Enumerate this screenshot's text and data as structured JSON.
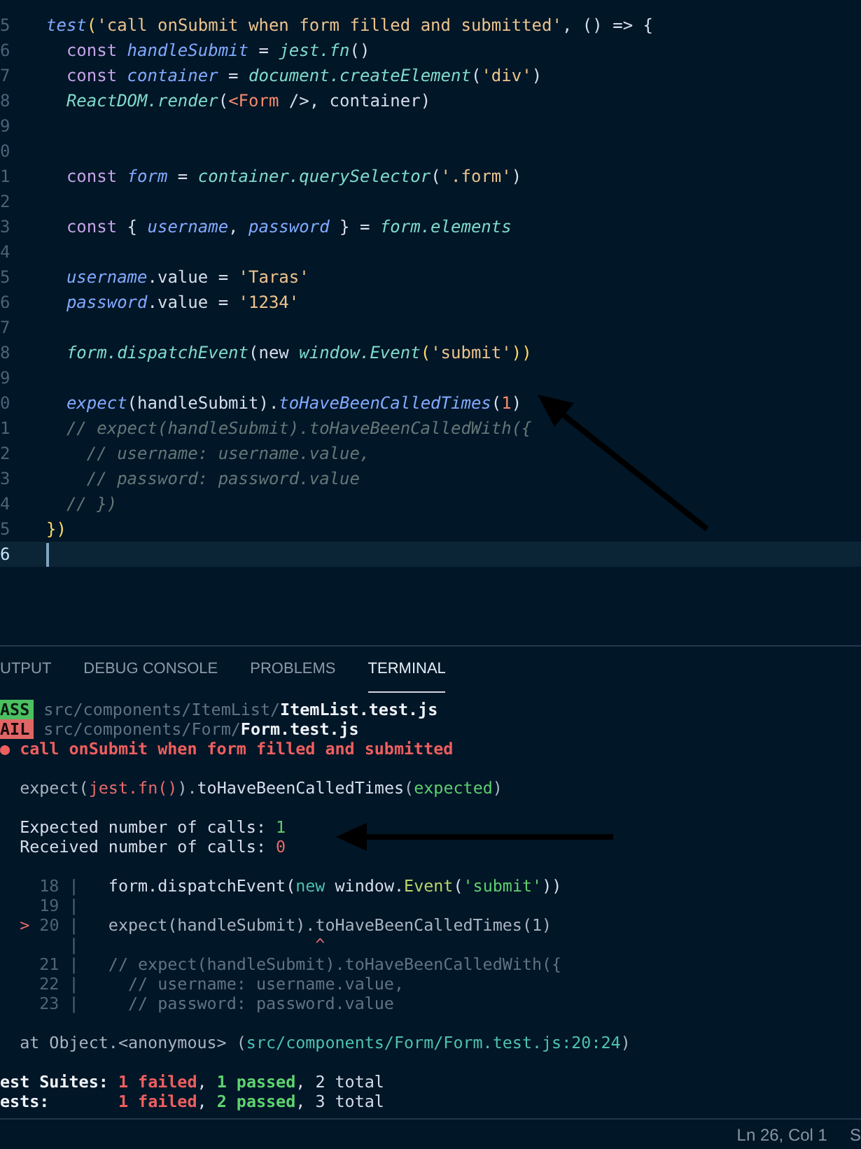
{
  "editor": {
    "lines": [
      {
        "number": "5",
        "current": false,
        "tokens": [
          {
            "kind": "var",
            "text": "test"
          },
          {
            "kind": "paren",
            "text": "("
          },
          {
            "kind": "str",
            "text": "'call onSubmit when form filled and submitted'"
          },
          {
            "kind": "punct",
            "text": ", () => {"
          }
        ]
      },
      {
        "number": "6",
        "current": false,
        "tokens": [
          {
            "kind": "kw",
            "text": "  const "
          },
          {
            "kind": "var",
            "text": "handleSubmit"
          },
          {
            "kind": "punct",
            "text": " = "
          },
          {
            "kind": "fn",
            "text": "jest.fn"
          },
          {
            "kind": "punct",
            "text": "()"
          }
        ]
      },
      {
        "number": "7",
        "current": false,
        "tokens": [
          {
            "kind": "kw",
            "text": "  const "
          },
          {
            "kind": "var",
            "text": "container"
          },
          {
            "kind": "punct",
            "text": " = "
          },
          {
            "kind": "fn",
            "text": "document.createElement"
          },
          {
            "kind": "punct",
            "text": "("
          },
          {
            "kind": "str",
            "text": "'div'"
          },
          {
            "kind": "punct",
            "text": ")"
          }
        ]
      },
      {
        "number": "8",
        "current": false,
        "tokens": [
          {
            "kind": "fn",
            "text": "  ReactDOM.render"
          },
          {
            "kind": "punct",
            "text": "("
          },
          {
            "kind": "tag",
            "text": "<Form"
          },
          {
            "kind": "punct",
            "text": " />, container)"
          }
        ]
      },
      {
        "number": "9",
        "current": false
      },
      {
        "number": "0",
        "current": false
      },
      {
        "number": "1",
        "current": false,
        "tokens": [
          {
            "kind": "kw",
            "text": "  const "
          },
          {
            "kind": "var",
            "text": "form"
          },
          {
            "kind": "punct",
            "text": " = "
          },
          {
            "kind": "fn",
            "text": "container.querySelector"
          },
          {
            "kind": "punct",
            "text": "("
          },
          {
            "kind": "str",
            "text": "'.form'"
          },
          {
            "kind": "punct",
            "text": ")"
          }
        ]
      },
      {
        "number": "2",
        "current": false
      },
      {
        "number": "3",
        "current": false,
        "tokens": [
          {
            "kind": "kw",
            "text": "  const "
          },
          {
            "kind": "punct",
            "text": "{ "
          },
          {
            "kind": "var",
            "text": "username"
          },
          {
            "kind": "punct",
            "text": ", "
          },
          {
            "kind": "var",
            "text": "password"
          },
          {
            "kind": "punct",
            "text": " } = "
          },
          {
            "kind": "fn",
            "text": "form.elements"
          }
        ]
      },
      {
        "number": "4",
        "current": false
      },
      {
        "number": "5",
        "current": false,
        "tokens": [
          {
            "kind": "var",
            "text": "  username"
          },
          {
            "kind": "punct",
            "text": ".value = "
          },
          {
            "kind": "str",
            "text": "'Taras'"
          }
        ]
      },
      {
        "number": "6",
        "current": false,
        "tokens": [
          {
            "kind": "var",
            "text": "  password"
          },
          {
            "kind": "punct",
            "text": ".value = "
          },
          {
            "kind": "str",
            "text": "'1234'"
          }
        ]
      },
      {
        "number": "7",
        "current": false
      },
      {
        "number": "8",
        "current": false,
        "tokens": [
          {
            "kind": "fn",
            "text": "  form.dispatchEvent"
          },
          {
            "kind": "punct",
            "text": "(new "
          },
          {
            "kind": "fn",
            "text": "window.Event"
          },
          {
            "kind": "paren",
            "text": "("
          },
          {
            "kind": "str",
            "text": "'submit'"
          },
          {
            "kind": "paren",
            "text": "))"
          }
        ]
      },
      {
        "number": "9",
        "current": false
      },
      {
        "number": "0",
        "current": false,
        "tokens": [
          {
            "kind": "var",
            "text": "  expect"
          },
          {
            "kind": "punct",
            "text": "(handleSubmit)."
          },
          {
            "kind": "var",
            "text": "toHaveBeenCalledTimes"
          },
          {
            "kind": "punct",
            "text": "("
          },
          {
            "kind": "num",
            "text": "1"
          },
          {
            "kind": "punct",
            "text": ")"
          }
        ]
      },
      {
        "number": "1",
        "current": false,
        "tokens": [
          {
            "kind": "cmt",
            "text": "  // expect(handleSubmit).toHaveBeenCalledWith({"
          }
        ]
      },
      {
        "number": "2",
        "current": false,
        "tokens": [
          {
            "kind": "cmt",
            "text": "    // username: username.value,"
          }
        ]
      },
      {
        "number": "3",
        "current": false,
        "tokens": [
          {
            "kind": "cmt",
            "text": "    // password: password.value"
          }
        ]
      },
      {
        "number": "4",
        "current": false,
        "tokens": [
          {
            "kind": "cmt",
            "text": "  // })"
          }
        ]
      },
      {
        "number": "5",
        "current": false,
        "tokens": [
          {
            "kind": "paren",
            "text": "})"
          }
        ]
      },
      {
        "number": "6",
        "current": true
      }
    ]
  },
  "panel_tabs": [
    {
      "label": "UTPUT",
      "selected": false
    },
    {
      "label": "DEBUG CONSOLE",
      "selected": false
    },
    {
      "label": "PROBLEMS",
      "selected": false
    },
    {
      "label": "TERMINAL",
      "selected": true
    }
  ],
  "terminal": {
    "lines": [
      {
        "kind": "output",
        "tokens": [
          {
            "kind": "pass",
            "text": "ASS"
          },
          {
            "kind": "dim",
            "text": " src/components/ItemList/"
          },
          {
            "kind": "bold",
            "text": "ItemList.test.js"
          }
        ]
      },
      {
        "kind": "output",
        "tokens": [
          {
            "kind": "fail",
            "text": "AIL"
          },
          {
            "kind": "dim",
            "text": " src/components/Form/"
          },
          {
            "kind": "bold",
            "text": "Form.test.js"
          }
        ]
      },
      {
        "kind": "output",
        "tokens": [
          {
            "kind": "redbold",
            "text": "● call onSubmit when form filled and submitted"
          }
        ]
      },
      {
        "kind": "blank"
      },
      {
        "kind": "output",
        "tokens": [
          {
            "kind": "grey",
            "text": "  expect("
          },
          {
            "kind": "red",
            "text": "jest.fn()"
          },
          {
            "kind": "grey",
            "text": ")."
          },
          {
            "kind": "plain",
            "text": "toHaveBeenCalledTimes"
          },
          {
            "kind": "grey",
            "text": "("
          },
          {
            "kind": "green",
            "text": "expected"
          },
          {
            "kind": "grey",
            "text": ")"
          }
        ]
      },
      {
        "kind": "blank"
      },
      {
        "kind": "output",
        "tokens": [
          {
            "kind": "plain",
            "text": "  Expected number of calls: "
          },
          {
            "kind": "green",
            "text": "1"
          }
        ]
      },
      {
        "kind": "output",
        "tokens": [
          {
            "kind": "plain",
            "text": "  Received number of calls: "
          },
          {
            "kind": "red",
            "text": "0"
          }
        ]
      },
      {
        "kind": "blank"
      },
      {
        "kind": "output",
        "tokens": [
          {
            "kind": "gutter",
            "text": "    18 |"
          },
          {
            "kind": "plain",
            "text": "   form.dispatchEvent("
          },
          {
            "kind": "teal",
            "text": "new"
          },
          {
            "kind": "plain",
            "text": " window."
          },
          {
            "kind": "lime",
            "text": "Event"
          },
          {
            "kind": "plain",
            "text": "("
          },
          {
            "kind": "green",
            "text": "'submit'"
          },
          {
            "kind": "plain",
            "text": "))"
          }
        ]
      },
      {
        "kind": "output",
        "tokens": [
          {
            "kind": "gutter",
            "text": "    19 |"
          }
        ]
      },
      {
        "kind": "output",
        "tokens": [
          {
            "kind": "red",
            "text": "  > "
          },
          {
            "kind": "gutter",
            "text": "20 |"
          },
          {
            "kind": "grey",
            "text": "   expect(handleSubmit).toHaveBeenCalledTimes(1)"
          }
        ]
      },
      {
        "kind": "output",
        "tokens": [
          {
            "kind": "gutter",
            "text": "       |"
          },
          {
            "kind": "red",
            "text": "                        ^"
          }
        ]
      },
      {
        "kind": "output",
        "tokens": [
          {
            "kind": "gutter",
            "text": "    21 |"
          },
          {
            "kind": "dim",
            "text": "   // expect(handleSubmit).toHaveBeenCalledWith({"
          }
        ]
      },
      {
        "kind": "output",
        "tokens": [
          {
            "kind": "gutter",
            "text": "    22 |"
          },
          {
            "kind": "dim",
            "text": "     // username: username.value,"
          }
        ]
      },
      {
        "kind": "output",
        "tokens": [
          {
            "kind": "gutter",
            "text": "    23 |"
          },
          {
            "kind": "dim",
            "text": "     // password: password.value"
          }
        ]
      },
      {
        "kind": "blank"
      },
      {
        "kind": "output",
        "tokens": [
          {
            "kind": "grey",
            "text": "  at Object.<anonymous> ("
          },
          {
            "kind": "teal",
            "text": "src/components/Form/Form.test.js:20:24"
          },
          {
            "kind": "grey",
            "text": ")"
          }
        ]
      },
      {
        "kind": "blank"
      },
      {
        "kind": "output",
        "tokens": [
          {
            "kind": "bold",
            "text": "est Suites: "
          },
          {
            "kind": "redbold",
            "text": "1 failed"
          },
          {
            "kind": "plain",
            "text": ", "
          },
          {
            "kind": "greenbold",
            "text": "1 passed"
          },
          {
            "kind": "plain",
            "text": ", 2 total"
          }
        ]
      },
      {
        "kind": "output",
        "tokens": [
          {
            "kind": "bold",
            "text": "ests:       "
          },
          {
            "kind": "redbold",
            "text": "1 failed"
          },
          {
            "kind": "plain",
            "text": ", "
          },
          {
            "kind": "greenbold",
            "text": "2 passed"
          },
          {
            "kind": "plain",
            "text": ", 3 total"
          }
        ]
      }
    ]
  },
  "status_bar": {
    "items": [
      "Ln 26, Col 1",
      "S"
    ]
  }
}
